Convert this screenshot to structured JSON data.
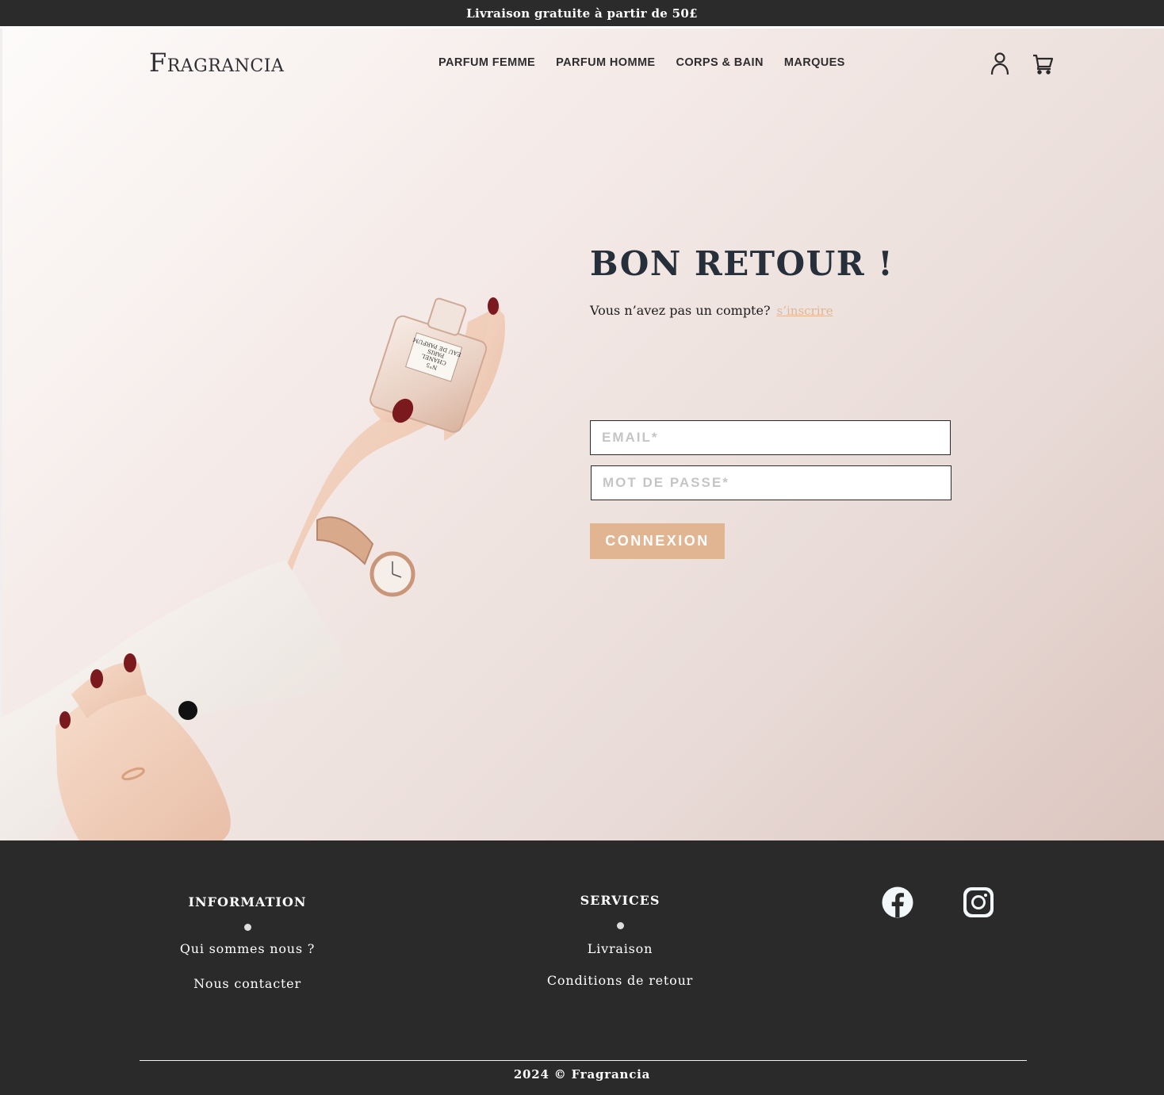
{
  "promo": {
    "text": "Livraison gratuite à partir de 50£"
  },
  "header": {
    "logo": "Fragrancia",
    "nav": [
      "PARFUM FEMME",
      "PARFUM HOMME",
      "CORPS & BAIN",
      "MARQUES"
    ]
  },
  "illustration": {
    "bottle_lines": [
      "N°5",
      "CHANEL",
      "PARIS",
      "EAU DE PARFUM"
    ]
  },
  "login": {
    "title": "BON RETOUR !",
    "no_account": "Vous n’avez pas un compte?",
    "signup_link": "s’inscrire",
    "email_placeholder": "EMAIL*",
    "password_placeholder": "MOT DE PASSE*",
    "submit_label": "CONNEXION"
  },
  "footer": {
    "information": {
      "title": "INFORMATION",
      "links": [
        "Qui sommes nous ?",
        "Nous contacter"
      ]
    },
    "services": {
      "title": "SERVICES",
      "links": [
        "Livraison",
        "Conditions de retour"
      ]
    },
    "social": [
      "facebook-icon",
      "instagram-icon"
    ],
    "copyright": "2024 © Fragrancia"
  },
  "colors": {
    "dark": "#2a2a2a",
    "accent": "#e2b592",
    "title": "#262f3a"
  }
}
